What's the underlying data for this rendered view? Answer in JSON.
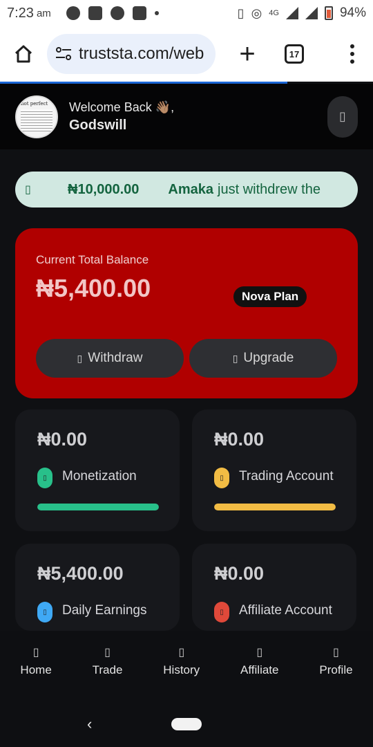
{
  "status_bar": {
    "time": "7:23",
    "ampm": "am",
    "battery_percent": "94%",
    "network": "4G"
  },
  "browser": {
    "url": "truststa.com/web",
    "tab_count": "17"
  },
  "header": {
    "welcome": "Welcome Back 👋🏽,",
    "username": "Godswill",
    "avatar_text": "not perfect"
  },
  "ticker": {
    "amount": "₦10,000.00",
    "name": "Amaka",
    "message": "just withdrew the",
    "colors": {
      "bg": "#d1e8e1",
      "text": "#14643f"
    }
  },
  "balance": {
    "label": "Current Total Balance",
    "value": "₦5,400.00",
    "plan": "Nova Plan",
    "withdraw_label": "Withdraw",
    "upgrade_label": "Upgrade",
    "card_color": "#b00000"
  },
  "stats": [
    {
      "value": "₦0.00",
      "label": "Monetization",
      "color": "#28c08a",
      "progress": 1.0
    },
    {
      "value": "₦0.00",
      "label": "Trading Account",
      "color": "#f2bc44",
      "progress": 1.0
    },
    {
      "value": "₦5,400.00",
      "label": "Daily Earnings",
      "color": "#3fa9f5"
    },
    {
      "value": "₦0.00",
      "label": "Affiliate Account",
      "color": "#e0493a"
    }
  ],
  "nav": [
    {
      "label": "Home",
      "icon": "home-icon"
    },
    {
      "label": "Trade",
      "icon": "trade-icon"
    },
    {
      "label": "History",
      "icon": "history-icon"
    },
    {
      "label": "Affiliate",
      "icon": "affiliate-icon"
    },
    {
      "label": "Profile",
      "icon": "profile-icon"
    }
  ]
}
